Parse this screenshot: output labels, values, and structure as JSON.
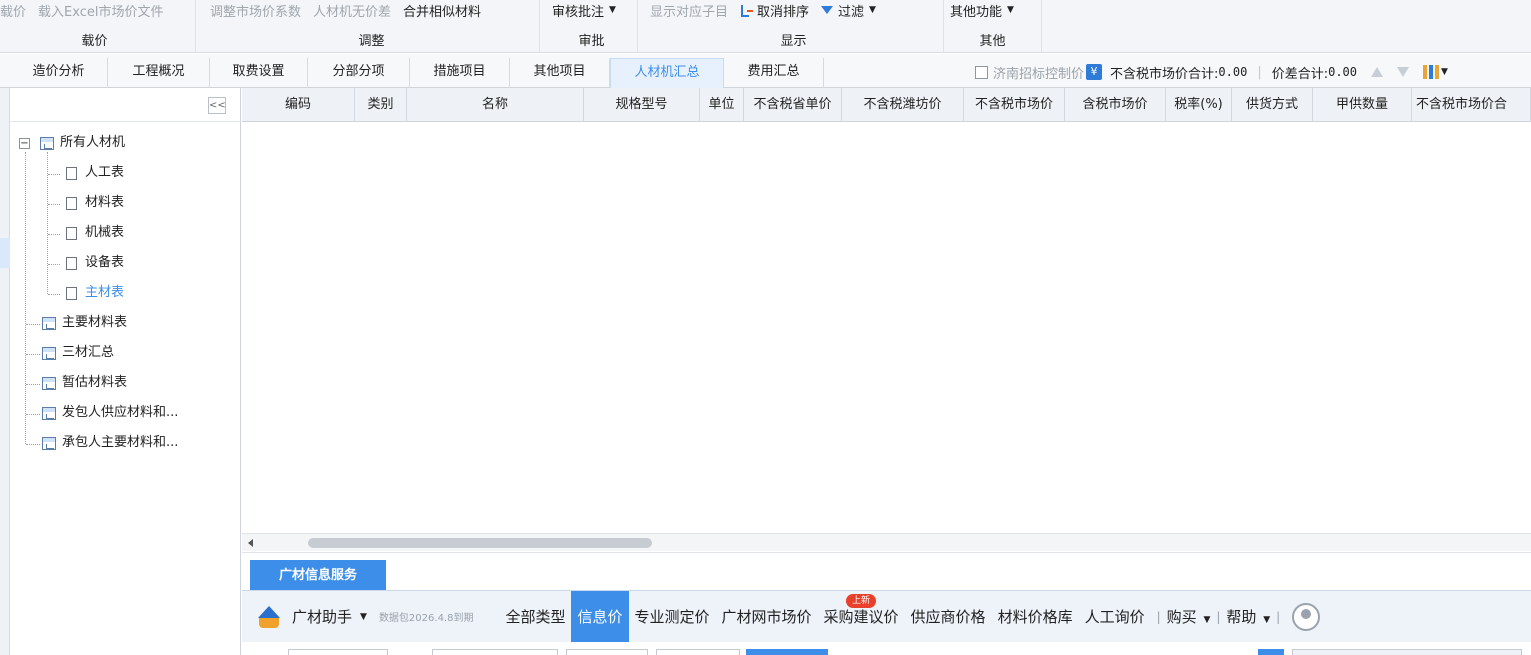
{
  "ribbon": {
    "groups": [
      {
        "name": "载价",
        "buttons": [
          {
            "label": "载价",
            "disabled": true
          },
          {
            "label": "载入Excel市场价文件",
            "disabled": true
          }
        ]
      },
      {
        "name": "调整",
        "buttons": [
          {
            "label": "调整市场价系数",
            "disabled": true
          },
          {
            "label": "人材机无价差",
            "disabled": true
          },
          {
            "label": "合并相似材料",
            "disabled": false
          }
        ]
      },
      {
        "name": "审批",
        "buttons": [
          {
            "label": "审核批注",
            "disabled": false
          }
        ]
      },
      {
        "name": "显示",
        "buttons": [
          {
            "label": "显示对应子目",
            "disabled": true
          },
          {
            "label": "取消排序",
            "disabled": false
          },
          {
            "label": "过滤",
            "disabled": false
          }
        ]
      },
      {
        "name": "其他",
        "buttons": [
          {
            "label": "其他功能",
            "disabled": false
          }
        ]
      }
    ]
  },
  "tabs": [
    "造价分析",
    "工程概况",
    "取费设置",
    "分部分项",
    "措施项目",
    "其他项目",
    "人材机汇总",
    "费用汇总"
  ],
  "active_tab": "人材机汇总",
  "toolbar_right": {
    "control_price_label": "济南招标控制价",
    "total_label": "不含税市场价合计:",
    "total_value": "0.00",
    "diff_label": "价差合计:",
    "diff_value": "0.00"
  },
  "tree": {
    "collapse_glyph": "<<",
    "root": "所有人材机",
    "children": [
      "人工表",
      "材料表",
      "机械表",
      "设备表",
      "主材表"
    ],
    "selected": "主材表",
    "others": [
      "主要材料表",
      "三材汇总",
      "暂估材料表",
      "发包人供应材料和...",
      "承包人主要材料和..."
    ]
  },
  "grid": {
    "columns": [
      "编码",
      "类别",
      "名称",
      "规格型号",
      "单位",
      "不含税省单价",
      "不含税潍坊价",
      "不含税市场价",
      "含税市场价",
      "税率(%)",
      "供货方式",
      "甲供数量",
      "不含税市场价合"
    ]
  },
  "service": {
    "tab_label": "广材信息服务",
    "assistant_label": "广材助手",
    "data_pack": "数据包2026.4.8到期",
    "nav": [
      "全部类型",
      "信息价",
      "专业测定价",
      "广材网市场价",
      "采购建议价",
      "供应商价格",
      "材料价格库",
      "人工询价"
    ],
    "active_nav": "信息价",
    "new_badge": "上新",
    "buy_label": "购买",
    "help_label": "帮助"
  }
}
